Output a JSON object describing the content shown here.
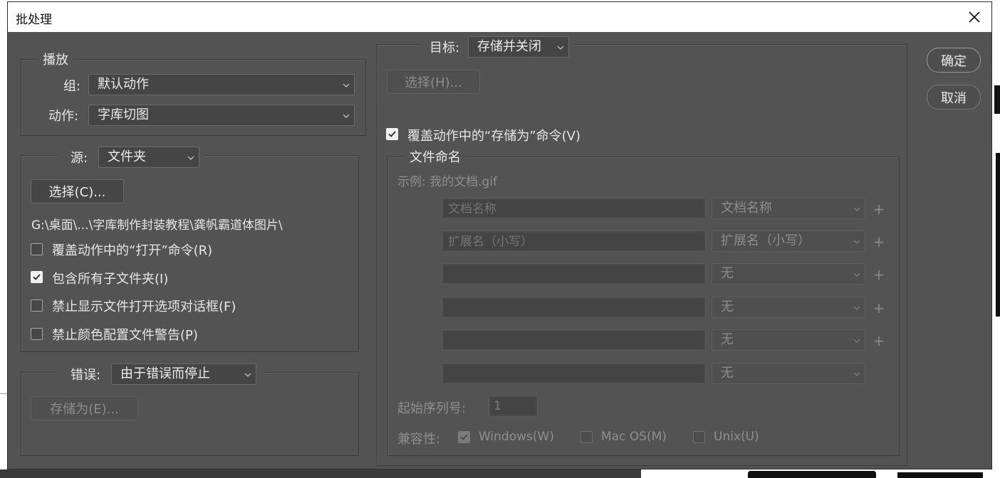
{
  "window": {
    "title": "批处理"
  },
  "buttons": {
    "ok": "确定",
    "cancel": "取消"
  },
  "play": {
    "legend": "播放",
    "set_label": "组:",
    "set_value": "默认动作",
    "action_label": "动作:",
    "action_value": "字库切图"
  },
  "source": {
    "label": "源:",
    "value": "文件夹",
    "choose_button": "选择(C)...",
    "path": "G:\\桌面\\...\\字库制作封装教程\\龚帆霸道体图片\\",
    "options": [
      {
        "label": "覆盖动作中的“打开”命令(R)",
        "checked": false
      },
      {
        "label": "包含所有子文件夹(I)",
        "checked": true
      },
      {
        "label": "禁止显示文件打开选项对话框(F)",
        "checked": false
      },
      {
        "label": "禁止颜色配置文件警告(P)",
        "checked": false
      }
    ]
  },
  "errors": {
    "label": "错误:",
    "value": "由于错误而停止",
    "save_as_button": "存储为(E)..."
  },
  "destination": {
    "label": "目标:",
    "value": "存储并关闭",
    "choose_button": "选择(H)...",
    "override_save_as": {
      "label": "覆盖动作中的“存储为”命令(V)",
      "checked": true
    }
  },
  "file_naming": {
    "legend": "文件命名",
    "example": "示例: 我的文档.gif",
    "rows": [
      {
        "field_placeholder": "文档名称",
        "select": "文档名称",
        "plus": "+"
      },
      {
        "field_placeholder": "扩展名（小写）",
        "select": "扩展名（小写）",
        "plus": "+"
      },
      {
        "field_placeholder": "",
        "select": "无",
        "plus": "+"
      },
      {
        "field_placeholder": "",
        "select": "无",
        "plus": "+"
      },
      {
        "field_placeholder": "",
        "select": "无",
        "plus": "+"
      },
      {
        "field_placeholder": "",
        "select": "无",
        "plus": ""
      }
    ],
    "start_serial_label": "起始序列号:",
    "start_serial_value": "1",
    "compat_label": "兼容性:",
    "compat": [
      {
        "label": "Windows(W)",
        "checked": true
      },
      {
        "label": "Mac OS(M)",
        "checked": false
      },
      {
        "label": "Unix(U)",
        "checked": false
      }
    ]
  }
}
